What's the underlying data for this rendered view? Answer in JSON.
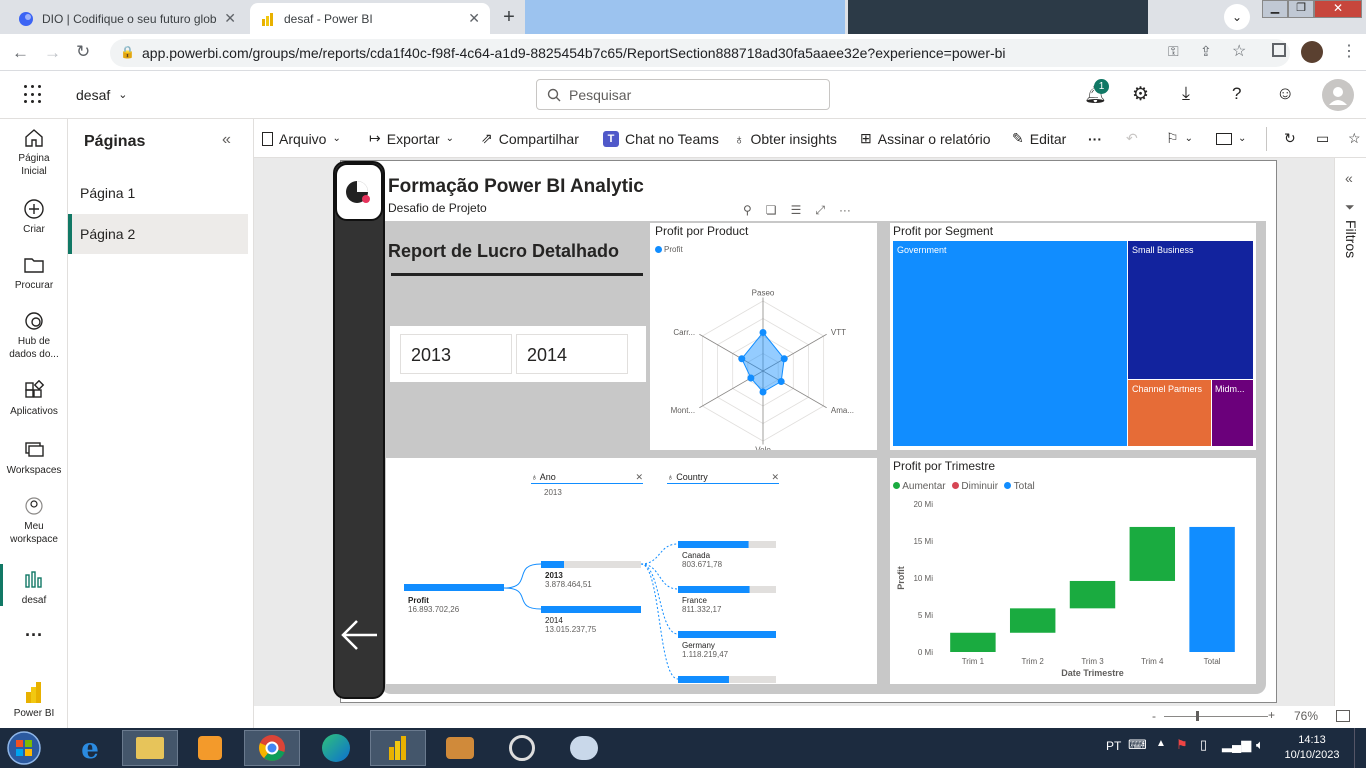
{
  "browser": {
    "tabs": [
      {
        "title": "DIO | Codifique o seu futuro glob",
        "active": false
      },
      {
        "title": "desaf - Power BI",
        "active": true
      }
    ],
    "url": "app.powerbi.com/groups/me/reports/cda1f40c-f98f-4c64-a1d9-8825454b7c65/ReportSection888718ad30fa5aaee32e?experience=power-bi"
  },
  "pbi": {
    "workspace": "desaf",
    "search_placeholder": "Pesquisar",
    "notification_count": "1"
  },
  "leftnav": [
    {
      "label": "Página Inicial",
      "icon": "home-icon"
    },
    {
      "label": "Criar",
      "icon": "plus-circle-icon"
    },
    {
      "label": "Procurar",
      "icon": "folder-icon"
    },
    {
      "label": "Hub de dados do...",
      "icon": "data-hub-icon"
    },
    {
      "label": "Aplicativos",
      "icon": "apps-icon"
    },
    {
      "label": "Workspaces",
      "icon": "workspaces-icon"
    },
    {
      "label": "Meu workspace",
      "icon": "my-workspace-icon"
    },
    {
      "label": "desaf",
      "icon": "report-icon"
    },
    {
      "label": "Power BI",
      "icon": "powerbi-logo-icon"
    }
  ],
  "pages_pane": {
    "title": "Páginas",
    "pages": [
      {
        "label": "Página 1",
        "active": false
      },
      {
        "label": "Página 2",
        "active": true
      }
    ]
  },
  "toolbar": {
    "arquivo": "Arquivo",
    "exportar": "Exportar",
    "compartilhar": "Compartilhar",
    "chat_teams": "Chat no Teams",
    "insights": "Obter insights",
    "assinar": "Assinar o relatório",
    "editar": "Editar"
  },
  "report": {
    "title": "Formação Power BI Analytic",
    "subtitle": "Desafio de Projeto",
    "section_title": "Report de Lucro Detalhado",
    "years": [
      "2013",
      "2014"
    ]
  },
  "radar": {
    "title": "Profit por Product",
    "legend": "Profit",
    "axes": [
      "Paseo",
      "VTT",
      "Ama...",
      "Velo",
      "Mont...",
      "Carr..."
    ],
    "values": [
      0.55,
      0.35,
      0.3,
      0.3,
      0.2,
      0.35
    ]
  },
  "treemap": {
    "title": "Profit por Segment",
    "segments": [
      {
        "name": "Government",
        "color": "#118dff"
      },
      {
        "name": "Small Business",
        "color": "#12239e"
      },
      {
        "name": "Channel Partners",
        "color": "#e66c37"
      },
      {
        "name": "Midm...",
        "color": "#6b007b"
      }
    ]
  },
  "decomp": {
    "filter1_label": "Ano",
    "filter1_value": "2013",
    "filter2_label": "Country",
    "root": {
      "label": "Profit",
      "value": "16.893.702,26"
    },
    "years": [
      {
        "label": "2013",
        "value": "3.878.464,51",
        "share": 0.23
      },
      {
        "label": "2014",
        "value": "13.015.237,75",
        "share": 0.77
      }
    ],
    "countries": [
      {
        "label": "Canada",
        "value": "803.671,78",
        "share": 0.72
      },
      {
        "label": "France",
        "value": "811.332,17",
        "share": 0.73
      },
      {
        "label": "Germany",
        "value": "1.118.219,47",
        "share": 1.0
      },
      {
        "label": "",
        "value": "",
        "share": 0.52
      }
    ]
  },
  "chart_data": {
    "type": "bar",
    "title": "Profit por Trimestre",
    "xlabel": "Date Trimestre",
    "ylabel": "Profit",
    "legend": [
      {
        "name": "Aumentar",
        "color": "#1aab40"
      },
      {
        "name": "Diminuir",
        "color": "#d64554"
      },
      {
        "name": "Total",
        "color": "#118dff"
      }
    ],
    "categories": [
      "Trim 1",
      "Trim 2",
      "Trim 3",
      "Trim 4",
      "Total"
    ],
    "ranges": [
      [
        0,
        2.6
      ],
      [
        2.6,
        5.9
      ],
      [
        5.9,
        9.6
      ],
      [
        9.6,
        16.9
      ],
      [
        0,
        16.9
      ]
    ],
    "kinds": [
      "Aumentar",
      "Aumentar",
      "Aumentar",
      "Aumentar",
      "Total"
    ],
    "yticks": [
      "0 Mi",
      "5 Mi",
      "10 Mi",
      "15 Mi",
      "20 Mi"
    ],
    "ylim": [
      0,
      20
    ]
  },
  "filters_label": "Filtros",
  "status": {
    "zoom": "76%"
  },
  "taskbar": {
    "lang": "PT",
    "time": "14:13",
    "date": "10/10/2023"
  }
}
